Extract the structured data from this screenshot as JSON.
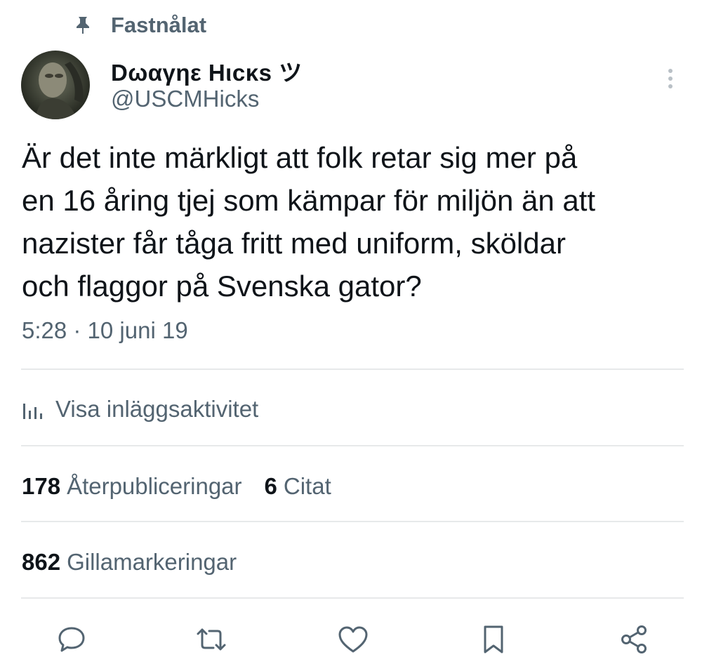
{
  "pinned": {
    "label": "Fastnålat",
    "icon": "pin-icon"
  },
  "author": {
    "display_name": "Dωαγηε Hιcκs ツ",
    "handle": "@USCMHicks",
    "avatar": "avatar"
  },
  "menu_icon": "more-vertical-icon",
  "tweet": {
    "lines": [
      "Är det inte märkligt att folk retar sig mer på",
      "en 16 åring tjej som kämpar för miljön än att",
      "nazister får tåga fritt med uniform, sköldar",
      "och flaggor på Svenska gator?"
    ],
    "timestamp": "5:28 · 10 juni 19"
  },
  "activity": {
    "label": "Visa inläggsaktivitet",
    "icon": "analytics-icon"
  },
  "stats": {
    "reposts_count": "178",
    "reposts_label": "Återpubliceringar",
    "quotes_count": "6",
    "quotes_label": "Citat",
    "likes_count": "862",
    "likes_label": "Gillamarkeringar"
  },
  "actions": [
    "reply-icon",
    "repost-icon",
    "like-icon",
    "bookmark-icon",
    "share-icon"
  ],
  "colors": {
    "text": "#0f1419",
    "secondary": "#536471",
    "divider": "#e7e9ea",
    "background": "#ffffff"
  }
}
